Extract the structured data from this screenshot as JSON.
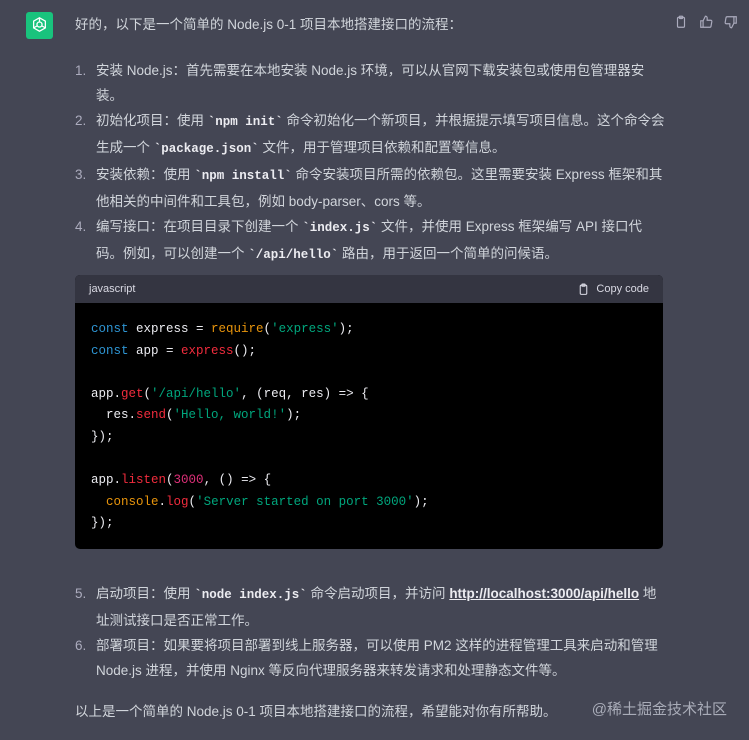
{
  "message": {
    "intro": "好的，以下是一个简单的 Node.js 0-1 项目本地搭建接口的流程：",
    "steps_a": [
      {
        "num": "1.",
        "t1": "安装 Node.js：首先需要在本地安装 Node.js 环境，可以从官网下载安装包或使用包管理器安装。"
      },
      {
        "num": "2.",
        "t1": "初始化项目：使用 ",
        "c1": "`npm init`",
        "t2": " 命令初始化一个新项目，并根据提示填写项目信息。这个命令会生成一个 ",
        "c2": "`package.json`",
        "t3": " 文件，用于管理项目依赖和配置等信息。"
      },
      {
        "num": "3.",
        "t1": "安装依赖：使用 ",
        "c1": "`npm install`",
        "t2": " 命令安装项目所需的依赖包。这里需要安装 Express 框架和其他相关的中间件和工具包，例如 body-parser、cors 等。"
      },
      {
        "num": "4.",
        "t1": "编写接口：在项目目录下创建一个 ",
        "c1": "`index.js`",
        "t2": " 文件，并使用 Express 框架编写 API 接口代码。例如，可以创建一个 ",
        "c2": "`/api/hello`",
        "t3": " 路由，用于返回一个简单的问候语。"
      }
    ],
    "code_block": {
      "language": "javascript",
      "copy_label": "Copy code",
      "lines": {
        "l1a": "const",
        "l1b": " express = ",
        "l1c": "require",
        "l1d": "(",
        "l1e": "'express'",
        "l1f": ");",
        "l2a": "const",
        "l2b": " app = ",
        "l2c": "express",
        "l2d": "();",
        "l4a": "app.",
        "l4b": "get",
        "l4c": "(",
        "l4d": "'/api/hello'",
        "l4e": ", (req, res) => {",
        "l5a": "  res.",
        "l5b": "send",
        "l5c": "(",
        "l5d": "'Hello, world!'",
        "l5e": ");",
        "l6": "});",
        "l8a": "app.",
        "l8b": "listen",
        "l8c": "(",
        "l8d": "3000",
        "l8e": ", () => {",
        "l9a": "  console",
        "l9b": ".",
        "l9c": "log",
        "l9d": "(",
        "l9e": "'Server started on port 3000'",
        "l9f": ");",
        "l10": "});"
      }
    },
    "steps_b": [
      {
        "num": "5.",
        "t1": "启动项目：使用 ",
        "c1": "`node index.js`",
        "t2": " 命令启动项目，并访问 ",
        "link": "http://localhost:3000/api/hello",
        "t3": " 地址测试接口是否正常工作。"
      },
      {
        "num": "6.",
        "t1": "部署项目：如果要将项目部署到线上服务器，可以使用 PM2 这样的进程管理工具来启动和管理 Node.js 进程，并使用 Nginx 等反向代理服务器来转发请求和处理静态文件等。"
      }
    ],
    "outro": "以上是一个简单的 Node.js 0-1 项目本地搭建接口的流程，希望能对你有所帮助。"
  },
  "watermark": "@稀土掘金技术社区",
  "icons": {
    "avatar": "openai-logo-icon",
    "copy": "clipboard-icon",
    "thumbs_up": "thumbs-up-icon",
    "thumbs_down": "thumbs-down-icon"
  },
  "colors": {
    "background": "#444654",
    "avatar_bg": "#19c37d",
    "code_bg": "#000000",
    "code_header_bg": "#343541"
  }
}
